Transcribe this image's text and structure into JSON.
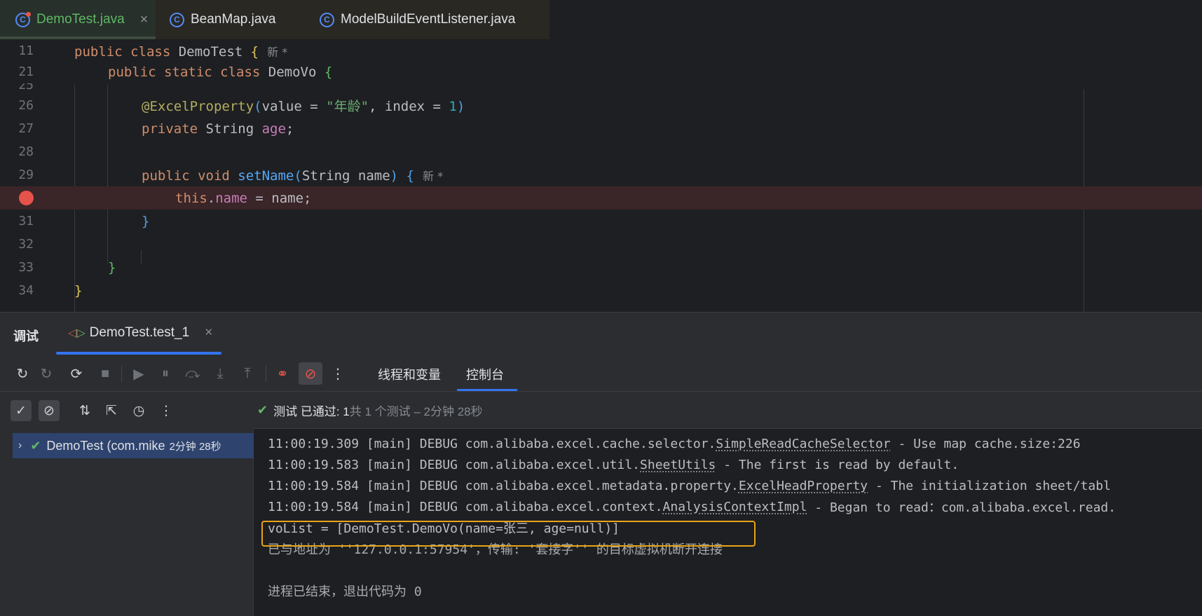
{
  "tabs": [
    {
      "label": "DemoTest.java",
      "icon": "class-icon",
      "close": "×"
    },
    {
      "label": "BeanMap.java",
      "icon": "class-icon"
    },
    {
      "label": "ModelBuildEventListener.java",
      "icon": "class-icon"
    }
  ],
  "editor": {
    "line_numbers": [
      "11",
      "21",
      "25",
      "26",
      "27",
      "28",
      "29",
      "31",
      "32",
      "33",
      "34"
    ],
    "hint_new": "新 *",
    "code": {
      "l11": {
        "kw": "public class ",
        "name": "DemoTest ",
        "brace": "{"
      },
      "l21": {
        "kw": "public static class ",
        "name": "DemoVo ",
        "brace": "{"
      },
      "l26": {
        "ann": "@ExcelProperty",
        "open": "(",
        "p1": "value = ",
        "s1": "\"年龄\"",
        "p2": ", index = ",
        "n1": "1",
        "close": ")"
      },
      "l27": {
        "kw": "private ",
        "type": "String ",
        "field": "age",
        "end": ";"
      },
      "l29": {
        "kw": "public void ",
        "fn": "setName",
        "open": "(",
        "params": "String name",
        "close": ")",
        "brace": " {"
      },
      "l30": {
        "kw": "this",
        "dot": ".",
        "field": "name",
        "rest": " = name;"
      },
      "l31": {
        "brace": "}"
      },
      "l33": {
        "brace": "}"
      },
      "l34": {
        "brace": "}"
      }
    }
  },
  "debug": {
    "title": "调试",
    "session_tab": "DemoTest.test_1",
    "tabs": [
      "线程和变量",
      "控制台"
    ],
    "more": "⋮"
  },
  "test_status": {
    "label": "测试 已通过: 1",
    "detail": "共 1 个测试 – 2分钟 28秒"
  },
  "tree": {
    "item": "DemoTest (com.mike",
    "time": "2分钟 28秒"
  },
  "console": {
    "lines": [
      {
        "pre": "11:00:19.309 [main] DEBUG com.alibaba.excel.cache.selector.",
        "link": "SimpleReadCacheSelector",
        "post": " - Use map cache.size:226"
      },
      {
        "pre": "11:00:19.583 [main] DEBUG com.alibaba.excel.util.",
        "link": "SheetUtils",
        "post": " - The first is read by default."
      },
      {
        "pre": "11:00:19.584 [main] DEBUG com.alibaba.excel.metadata.property.",
        "link": "ExcelHeadProperty",
        "post": " - The initialization sheet/tabl"
      },
      {
        "pre": "11:00:19.584 [main] DEBUG com.alibaba.excel.context.",
        "link": "AnalysisContextImpl",
        "post": " - Began to read：com.alibaba.excel.read."
      }
    ],
    "result": "voList = [DemoTest.DemoVo(name=张三, age=null)]",
    "disconnect": "已与地址为 ''127.0.0.1:57954'，传输: '套接字'' 的目标虚拟机断开连接",
    "exit": "进程已结束，退出代码为 0"
  },
  "colors": {
    "accent": "#3574f0",
    "pass": "#5fb865",
    "breakpoint": "#e5534b",
    "highlight": "#e8a317"
  }
}
